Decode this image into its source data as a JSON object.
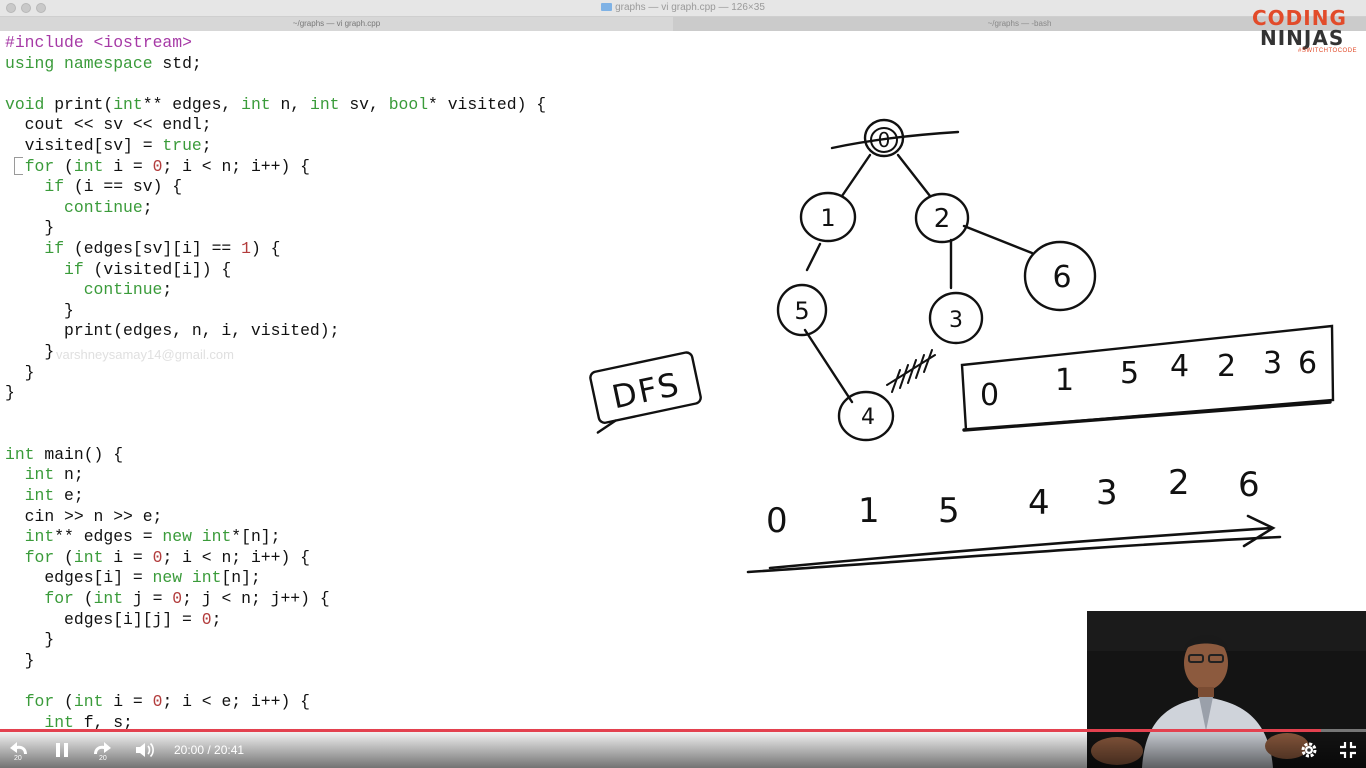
{
  "window": {
    "title": "graphs — vi graph.cpp — 126×35",
    "tabs": [
      {
        "label": "~/graphs — vi graph.cpp"
      },
      {
        "label": "~/graphs — -bash"
      }
    ]
  },
  "editor": {
    "watermark": "varshneysamay14@gmail.com"
  },
  "drawing": {
    "tree_nodes": [
      "0",
      "1",
      "2",
      "5",
      "3",
      "6",
      "4"
    ],
    "label": "DFS",
    "boxed_sequence": [
      "0",
      "1",
      "5",
      "4",
      "2",
      "3",
      "6"
    ],
    "bottom_sequence": [
      "0",
      "1",
      "5",
      "4",
      "3",
      "2",
      "6"
    ]
  },
  "logo": {
    "line1": "CODING",
    "line2": "NINJAS",
    "tagline": "#SWITCHTOCODE"
  },
  "player": {
    "time_current": "20:00",
    "time_total": "20:41",
    "time_display": "20:00 / 20:41",
    "rewind_seconds": "20",
    "forward_seconds": "20",
    "progress": 0.967,
    "accent_color": "#e3414f"
  }
}
